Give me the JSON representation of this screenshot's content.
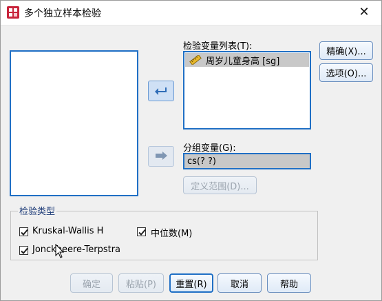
{
  "window": {
    "title": "多个独立样本检验",
    "close_icon": "close-icon"
  },
  "source_list": {
    "items": []
  },
  "test_vars": {
    "label": "检验变量列表(T):",
    "items": [
      {
        "label": "周岁儿童身高 [sg]",
        "icon": "ruler-icon"
      }
    ]
  },
  "group_var": {
    "label": "分组变量(G):",
    "value": "cs(? ?)",
    "define_range_label": "定义范围(D)..."
  },
  "side_buttons": {
    "exact_label": "精确(X)...",
    "options_label": "选项(O)..."
  },
  "test_type": {
    "legend": "检验类型",
    "kruskal": {
      "label": "Kruskal-Wallis H",
      "checked": true
    },
    "median": {
      "label": "中位数(M)",
      "checked": true
    },
    "jonckheere": {
      "label": "Jonckheere-Terpstra",
      "checked": true
    }
  },
  "footer": {
    "ok_label": "确定",
    "paste_label": "粘贴(P)",
    "reset_label": "重置(R)",
    "cancel_label": "取消",
    "help_label": "帮助"
  }
}
